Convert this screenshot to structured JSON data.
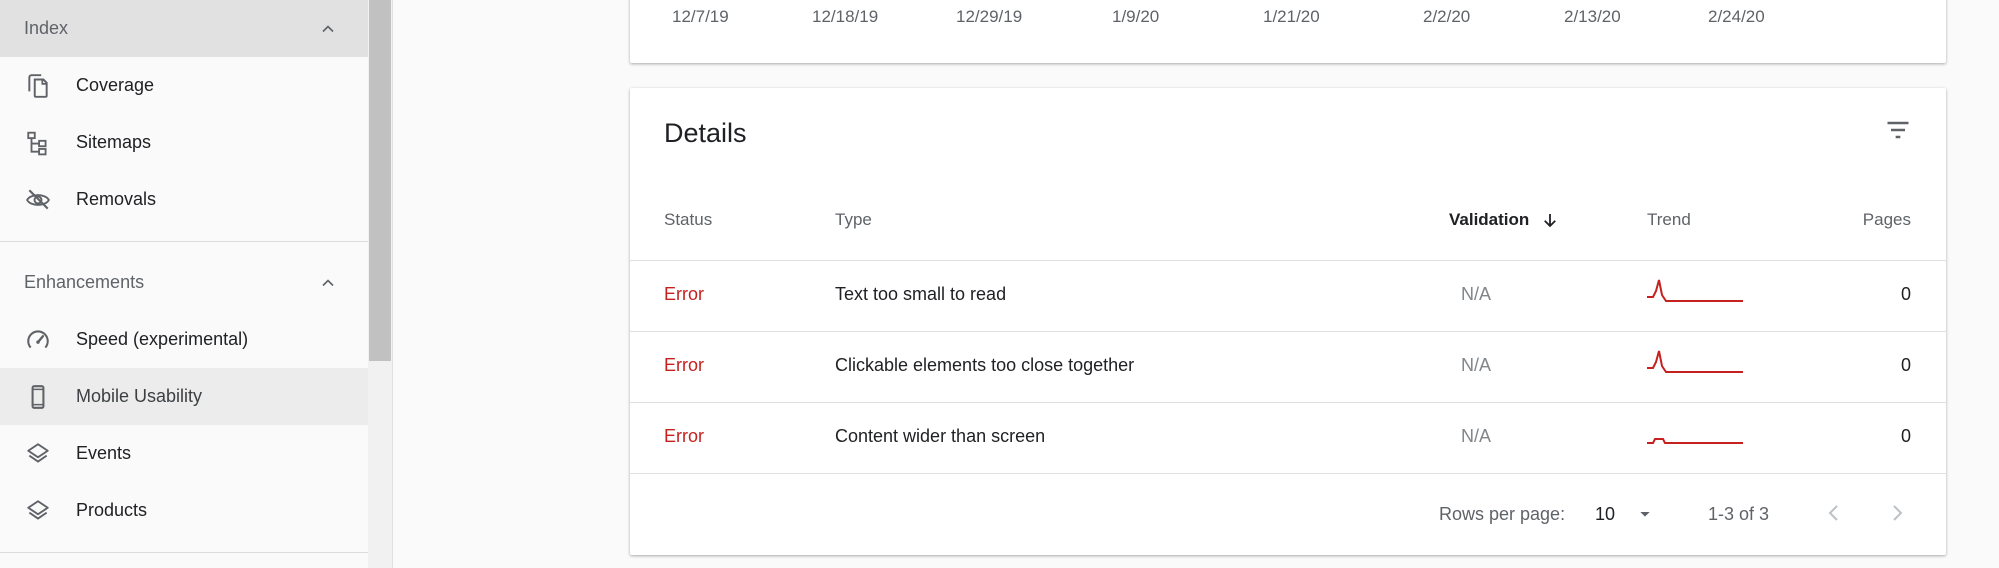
{
  "sidebar": {
    "index_section": {
      "label": "Index",
      "icon": "chevron-up-icon"
    },
    "index_items": [
      {
        "label": "Coverage",
        "icon": "copy-pages-icon"
      },
      {
        "label": "Sitemaps",
        "icon": "sitemap-tree-icon"
      },
      {
        "label": "Removals",
        "icon": "eye-off-icon"
      }
    ],
    "enhancements_section": {
      "label": "Enhancements",
      "icon": "chevron-up-icon"
    },
    "enhancement_items": [
      {
        "label": "Speed (experimental)",
        "icon": "speedometer-icon"
      },
      {
        "label": "Mobile Usability",
        "icon": "smartphone-icon",
        "active": true
      },
      {
        "label": "Events",
        "icon": "layers-icon"
      },
      {
        "label": "Products",
        "icon": "layers-icon"
      }
    ]
  },
  "chart_card": {
    "x_ticks": [
      "12/7/19",
      "12/18/19",
      "12/29/19",
      "1/9/20",
      "1/21/20",
      "2/2/20",
      "2/13/20",
      "2/24/20"
    ]
  },
  "details": {
    "title": "Details",
    "filter_icon": "filter-list-icon",
    "columns": {
      "status": "Status",
      "type": "Type",
      "validation": "Validation",
      "trend": "Trend",
      "pages": "Pages"
    },
    "sort_icon": "arrow-down-icon",
    "rows": [
      {
        "status": "Error",
        "type": "Text too small to read",
        "validation": "N/A",
        "pages": "0",
        "trend": "spike"
      },
      {
        "status": "Error",
        "type": "Clickable elements too close together",
        "validation": "N/A",
        "pages": "0",
        "trend": "spike"
      },
      {
        "status": "Error",
        "type": "Content wider than screen",
        "validation": "N/A",
        "pages": "0",
        "trend": "bump"
      }
    ],
    "pagination": {
      "rows_per_page_label": "Rows per page:",
      "rows_per_page_value": "10",
      "range": "1-3 of 3"
    }
  },
  "colors": {
    "error": "#c5221f",
    "active_nav_bg": "#ececec",
    "index_header_bg": "#e1e1e1"
  }
}
